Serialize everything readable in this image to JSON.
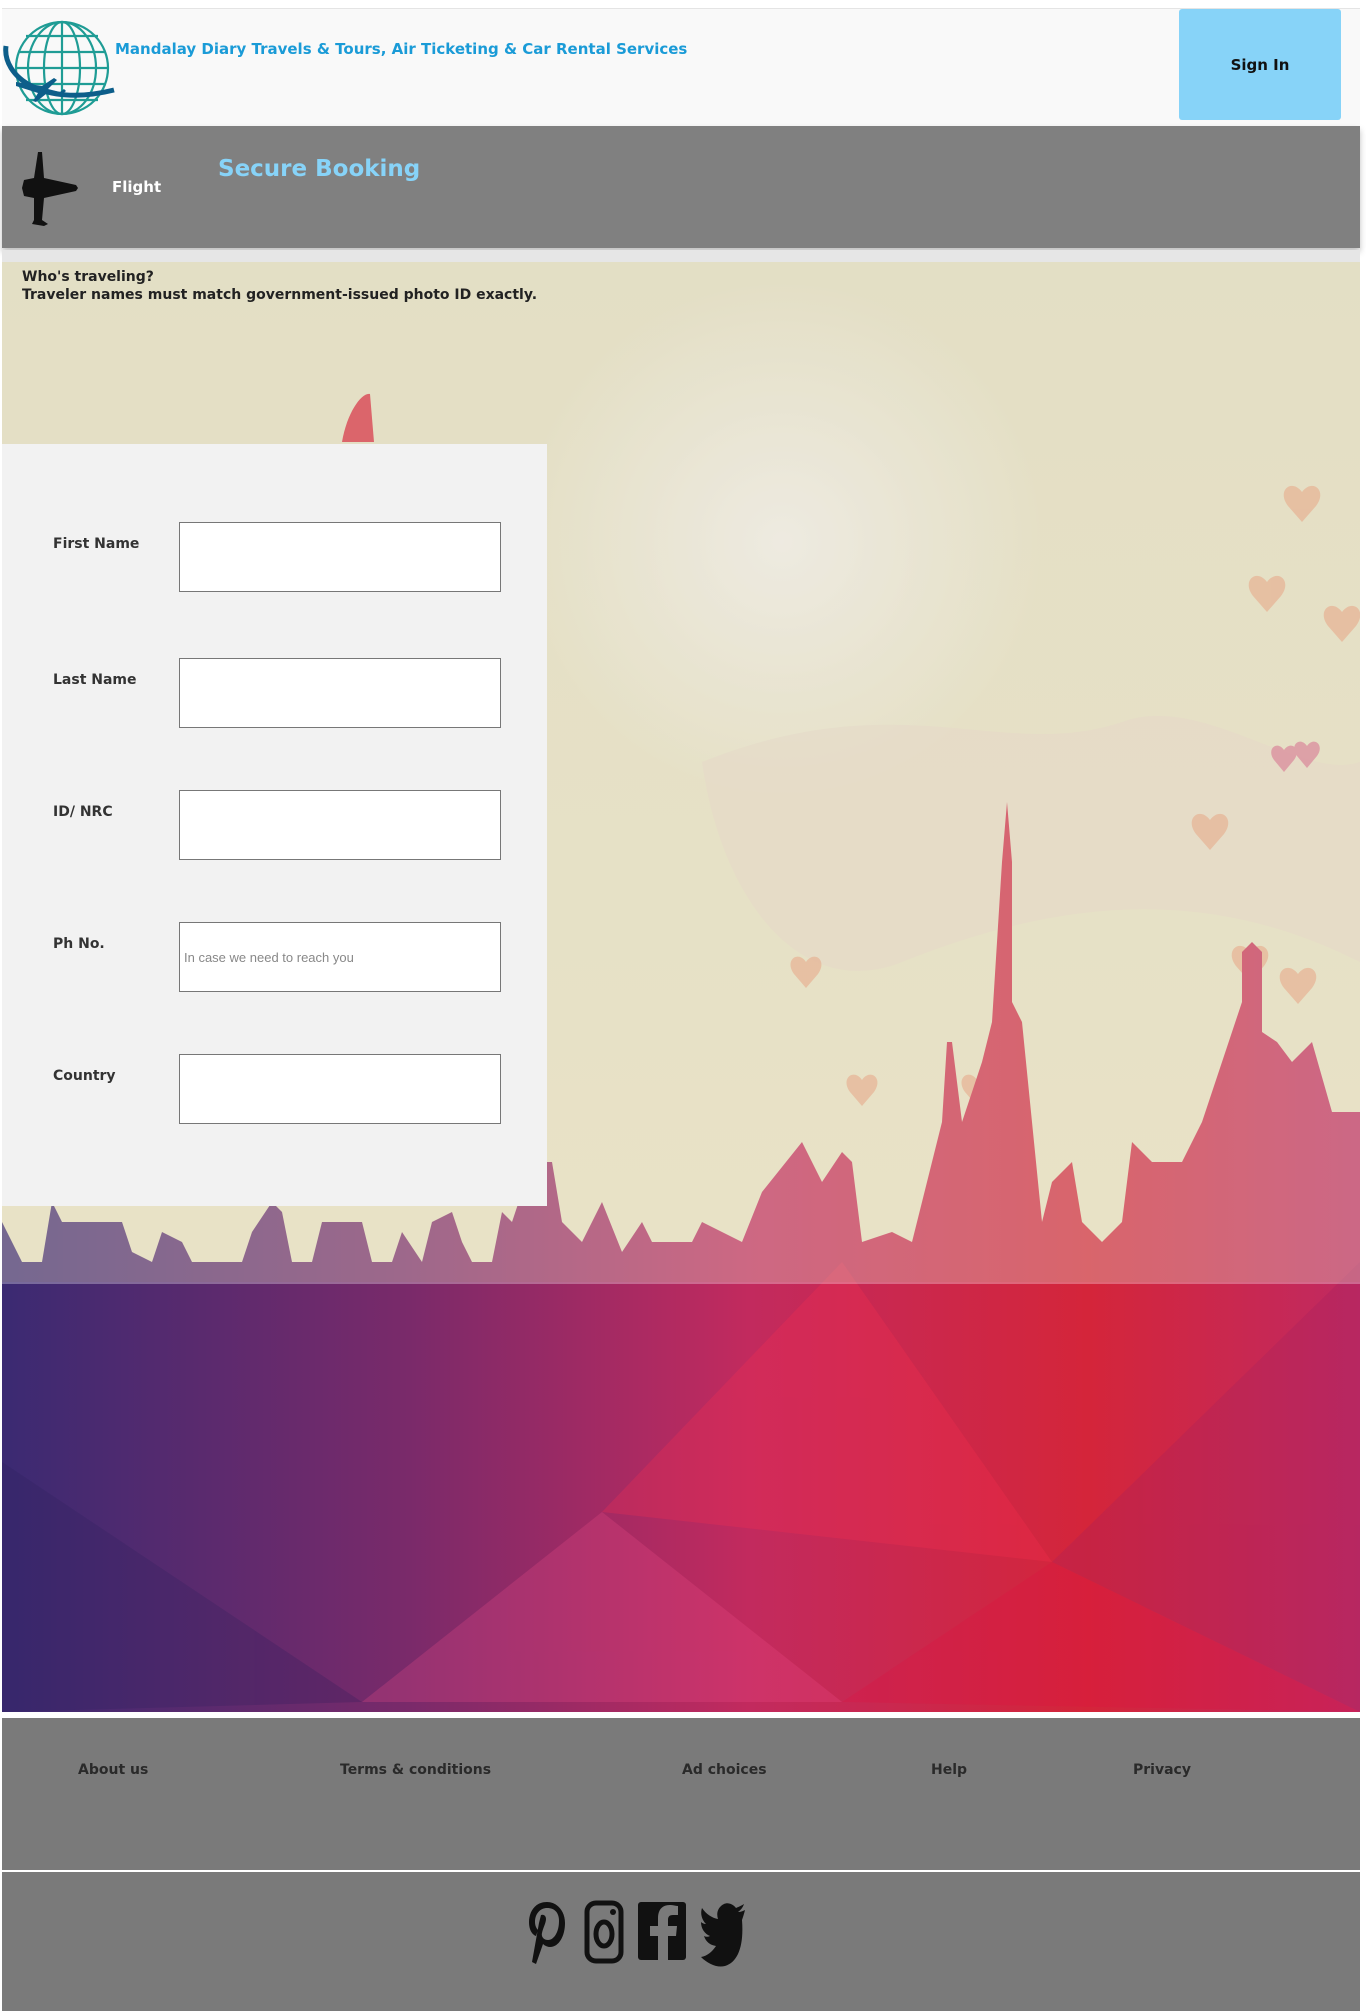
{
  "header": {
    "brand": "Mandalay Diary Travels & Tours, Air Ticketing & Car Rental Services",
    "sign_in": "Sign In"
  },
  "band": {
    "flight_label": "Flight",
    "title": "Secure Booking"
  },
  "traveler": {
    "heading": "Who's traveling?",
    "notice": "Traveler names must match government-issued photo ID exactly."
  },
  "form": {
    "first_name": {
      "label": "First Name",
      "value": "",
      "placeholder": ""
    },
    "last_name": {
      "label": "Last Name",
      "value": "",
      "placeholder": ""
    },
    "id_nrc": {
      "label": "ID/ NRC",
      "value": "",
      "placeholder": ""
    },
    "phone": {
      "label": "Ph No.",
      "value": "",
      "placeholder": "In case we need to reach you"
    },
    "country": {
      "label": "Country",
      "value": "",
      "placeholder": ""
    }
  },
  "footer": {
    "links": {
      "about": "About us",
      "terms": "Terms & conditions",
      "ads": "Ad choices",
      "help": "Help",
      "privacy": "Privacy"
    },
    "social_icons": [
      "pinterest-icon",
      "instagram-icon",
      "facebook-icon",
      "twitter-icon"
    ]
  },
  "colors": {
    "brand_text": "#1a9bd7",
    "sign_in_bg": "#87d3f8",
    "band_bg": "#808080",
    "title_text": "#87d3f8",
    "footer_bg": "#7a7a7a",
    "form_bg": "#f2f2f2"
  }
}
